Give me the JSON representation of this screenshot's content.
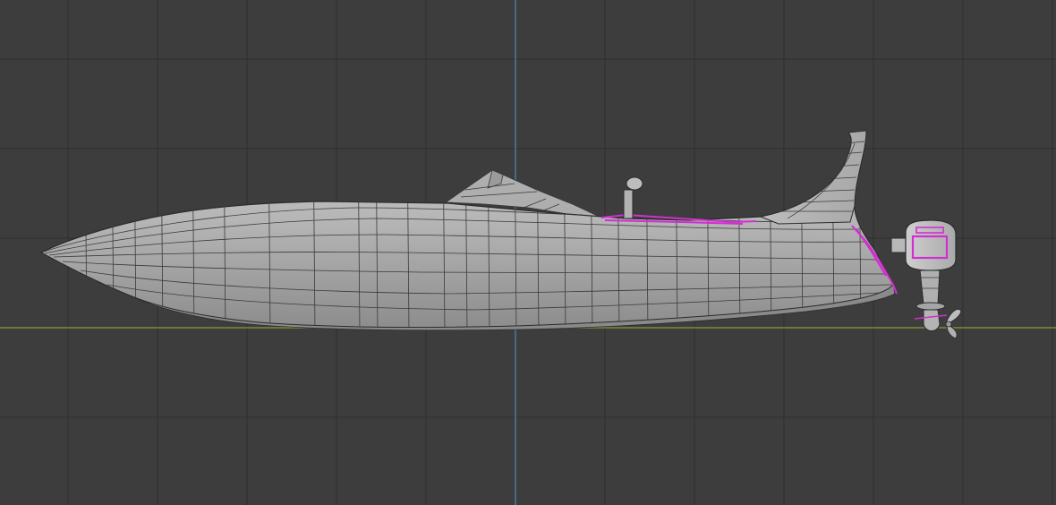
{
  "viewport": {
    "view": "side-orthographic",
    "colors": {
      "background": "#3d3d3d",
      "grid_line": "#2e2e2e",
      "grid_line_minor": "#363636",
      "axis_vertical": "#4a7fa6",
      "axis_horizontal": "#8a9a3a",
      "mesh_fill": "#b4b4b4",
      "mesh_fill_light": "#c6c6c6",
      "mesh_fill_dark": "#8f8f8f",
      "mesh_wire": "#3a3a3a",
      "selection": "#d12fd1"
    }
  },
  "object": {
    "type": "speedboat-mesh",
    "parts": [
      "hull",
      "windshield",
      "rear-fin",
      "mirror",
      "outboard-motor",
      "propeller"
    ]
  }
}
